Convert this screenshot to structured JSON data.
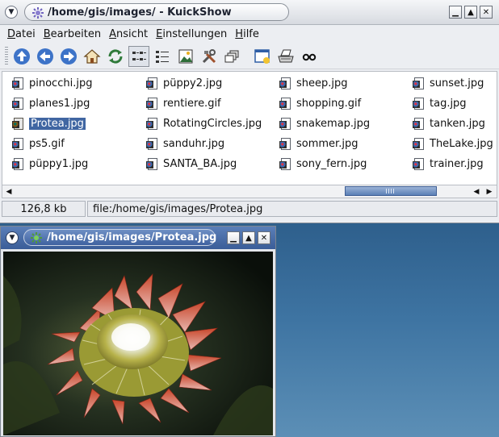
{
  "main_window": {
    "title": "/home/gis/images/ - KuickShow",
    "buttons": {
      "minimize": "_",
      "maximize": "▲",
      "close": "✕",
      "menu": "⌄"
    }
  },
  "menubar": [
    {
      "label": "Datei"
    },
    {
      "label": "Bearbeiten"
    },
    {
      "label": "Ansicht"
    },
    {
      "label": "Einstellungen"
    },
    {
      "label": "Hilfe"
    }
  ],
  "toolbar": [
    {
      "icon": "up-arrow-icon"
    },
    {
      "icon": "back-arrow-icon"
    },
    {
      "icon": "forward-arrow-icon"
    },
    {
      "icon": "home-icon"
    },
    {
      "icon": "reload-icon"
    },
    {
      "icon": "short-view-icon"
    },
    {
      "icon": "detail-view-icon"
    },
    {
      "icon": "show-image-icon"
    },
    {
      "icon": "tools-icon"
    },
    {
      "icon": "windows-icon"
    },
    {
      "icon": "slideshow-icon"
    },
    {
      "icon": "print-icon"
    },
    {
      "icon": "glasses-icon"
    }
  ],
  "files": {
    "columns": [
      [
        "pinocchi.jpg",
        "planes1.jpg",
        "Protea.jpg",
        "ps5.gif",
        "püppy1.jpg"
      ],
      [
        "püppy2.jpg",
        "rentiere.gif",
        "RotatingCircles.jpg",
        "sanduhr.jpg",
        "SANTA_BA.jpg"
      ],
      [
        "sheep.jpg",
        "shopping.gif",
        "snakemap.jpg",
        "sommer.jpg",
        "sony_fern.jpg"
      ],
      [
        "sunset.jpg",
        "tag.jpg",
        "tanken.jpg",
        "TheLake.jpg",
        "trainer.jpg"
      ]
    ],
    "selected": "Protea.jpg"
  },
  "statusbar": {
    "size": "126,8 kb",
    "path": "file:/home/gis/images/Protea.jpg"
  },
  "image_window": {
    "title": "/home/gis/images/Protea.jpg"
  },
  "colors": {
    "selection": "#4066a2",
    "image_titlebar": "#3a5d98",
    "desktop": "#3e74a2"
  }
}
